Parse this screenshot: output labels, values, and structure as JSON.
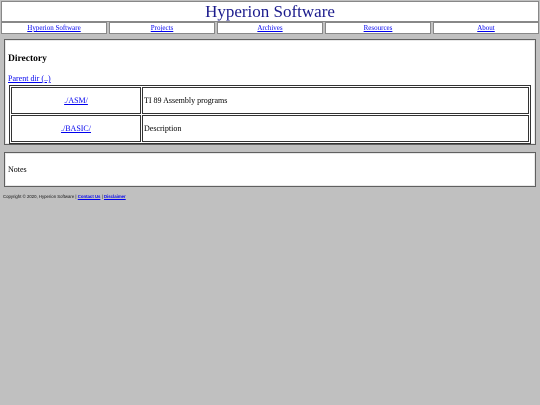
{
  "header": {
    "title": "Hyperion Software"
  },
  "nav": {
    "items": [
      {
        "label": "Hyperion Software"
      },
      {
        "label": "Projects"
      },
      {
        "label": "Archives"
      },
      {
        "label": "Resources"
      },
      {
        "label": "About"
      }
    ]
  },
  "directory": {
    "heading": "Directory",
    "parent_link": "Parent dir (..)",
    "entries": [
      {
        "name": "./ASM/",
        "description": "TI 89 Assembly programs"
      },
      {
        "name": "./BASIC/",
        "description": "Description"
      }
    ]
  },
  "notes": {
    "text": "Notes"
  },
  "footer": {
    "copyright": "Copyright © 2020, Hyperion Software |",
    "contact_label": "Contact Us",
    "separator": "|",
    "disclaimer_label": "Disclaimer"
  },
  "colors": {
    "background": "#c0c0c0",
    "title": "#1a1a8c",
    "link": "#0000ee"
  }
}
